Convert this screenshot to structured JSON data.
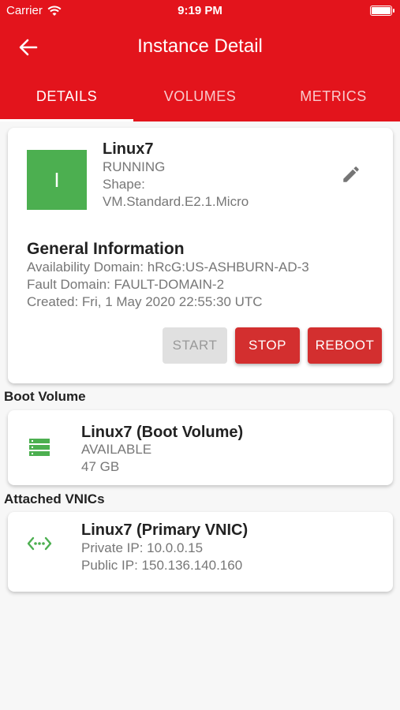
{
  "status_bar": {
    "carrier": "Carrier",
    "time": "9:19 PM"
  },
  "app_bar": {
    "title": "Instance Detail"
  },
  "tabs": [
    {
      "label": "DETAILS",
      "active": true
    },
    {
      "label": "VOLUMES",
      "active": false
    },
    {
      "label": "METRICS",
      "active": false
    }
  ],
  "instance": {
    "avatar_letter": "I",
    "avatar_color": "#4caf50",
    "name": "Linux7",
    "state": "RUNNING",
    "shape_label": "Shape:",
    "shape_value": "VM.Standard.E2.1.Micro"
  },
  "general_info": {
    "title": "General Information",
    "availability_domain": "Availability Domain: hRcG:US-ASHBURN-AD-3",
    "fault_domain": "Fault Domain: FAULT-DOMAIN-2",
    "created": "Created: Fri, 1 May 2020 22:55:30 UTC"
  },
  "actions": {
    "start": "START",
    "stop": "STOP",
    "reboot": "REBOOT"
  },
  "boot_volume": {
    "header": "Boot Volume",
    "icon": "storage-icon",
    "title": "Linux7 (Boot Volume)",
    "state": "AVAILABLE",
    "size": "47 GB"
  },
  "vnics": {
    "header": "Attached VNICs",
    "icon": "network-icon",
    "title": "Linux7 (Primary VNIC)",
    "private_ip": "Private IP: 10.0.0.15",
    "public_ip": "Public IP: 150.136.140.160"
  },
  "colors": {
    "brand": "#e3141c",
    "action": "#d32f2f",
    "success": "#4caf50"
  }
}
